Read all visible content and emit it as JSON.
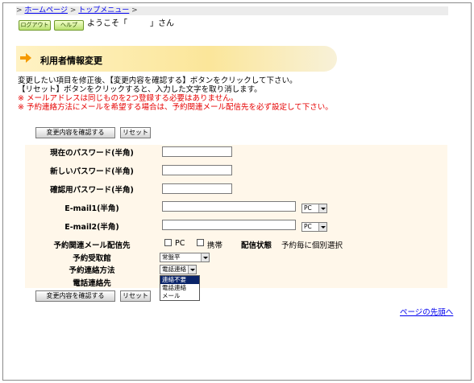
{
  "breadcrumb": {
    "prefix": ">",
    "home": "ホームページ",
    "sep": ">",
    "top_menu": "トップメニュー",
    "suffix": ">"
  },
  "header": {
    "logout_label": "ログアウト",
    "help_label": "ヘルプ",
    "welcome_prefix": "ようこそ「",
    "welcome_suffix": "」さん"
  },
  "page": {
    "title": "利用者情報変更",
    "note1": "変更したい項目を修正後、【変更内容を確認する】ボタンをクリックして下さい。",
    "note2": "【リセット】ボタンをクリックすると、入力した文字を取り消します。",
    "note3": "※ メールアドレスは同じものを2つ登録する必要はありません。",
    "note4": "※ 予約連絡方法にメールを希望する場合は、予約関連メール配信先を必ず設定して下さい。"
  },
  "buttons": {
    "confirm_label": "変更内容を確認する",
    "reset_label": "リセット"
  },
  "form": {
    "current_password_label": "現在のパスワード(半角)",
    "new_password_label": "新しいパスワード(半角)",
    "confirm_password_label": "確認用パスワード(半角)",
    "email1_label": "E-mail1(半角)",
    "email1_type": "PC",
    "email2_label": "E-mail2(半角)",
    "email2_type": "PC",
    "mail_dest_label": "予約関連メール配信先",
    "dest_pc_label": "PC",
    "dest_mobile_label": "携帯",
    "delivery_status_label": "配信状態",
    "delivery_status_value": "予約毎に個別選択",
    "pickup_label": "予約受取館",
    "pickup_value": "常盤平",
    "contact_method_label": "予約連絡方法",
    "contact_method_value": "電話連絡",
    "contact_method_options": [
      "連絡不要",
      "電話連絡",
      "メール"
    ],
    "phone_label": "電話連絡先"
  },
  "footer": {
    "page_top_link": "ページの先頭へ"
  },
  "colors": {
    "accent_orange": "#f59a00",
    "notice_red": "#e60000",
    "form_bg": "#fff7ea"
  }
}
